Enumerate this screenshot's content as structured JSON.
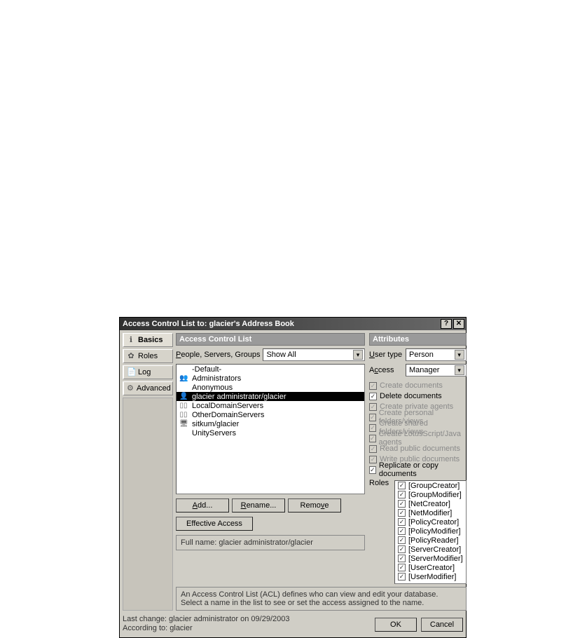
{
  "titlebar": {
    "title": "Access Control List to: glacier's Address Book",
    "help": "?",
    "close": "✕"
  },
  "sidebar": {
    "tabs": [
      {
        "icon": "ℹ",
        "label": "Basics"
      },
      {
        "icon": "✿",
        "label": "Roles"
      },
      {
        "icon": "📄",
        "label": "Log"
      },
      {
        "icon": "⚙",
        "label": "Advanced"
      }
    ]
  },
  "acl": {
    "header": "Access Control List",
    "filter_label": "People, Servers, Groups",
    "filter_value": "Show All",
    "items": [
      {
        "icon": "",
        "label": "-Default-"
      },
      {
        "icon": "👥",
        "label": "Administrators"
      },
      {
        "icon": "",
        "label": "Anonymous"
      },
      {
        "icon": "👤",
        "label": "glacier administrator/glacier",
        "selected": true
      },
      {
        "icon": "▯▯",
        "label": "LocalDomainServers"
      },
      {
        "icon": "▯▯",
        "label": "OtherDomainServers"
      },
      {
        "icon": "🖥",
        "label": "sitkum/glacier"
      },
      {
        "icon": "",
        "label": "UnityServers"
      }
    ],
    "buttons": {
      "add": "Add...",
      "rename": "Rename...",
      "remove": "Remove",
      "effective": "Effective Access"
    },
    "fullname_label": "Full name: glacier administrator/glacier",
    "hint": "An Access Control List (ACL) defines who can view and edit your database. Select a name in the list to see or set the access assigned to the name."
  },
  "attributes": {
    "header": "Attributes",
    "usertype_label": "User type",
    "usertype_value": "Person",
    "access_label": "Access",
    "access_value": "Manager",
    "perms": [
      {
        "label": "Create documents",
        "checked": true,
        "disabled": true,
        "u": "C"
      },
      {
        "label": "Delete documents",
        "checked": true,
        "disabled": false,
        "u": "D"
      },
      {
        "label": "Create private agents",
        "checked": true,
        "disabled": true,
        "u2": "p"
      },
      {
        "label": "Create personal folders/views",
        "checked": true,
        "disabled": true,
        "u2": "e"
      },
      {
        "label": "Create shared folders/views",
        "checked": true,
        "disabled": true,
        "u": "s"
      },
      {
        "label": "Create LotusScript/Java agents",
        "checked": true,
        "disabled": true,
        "u": "L"
      },
      {
        "label": "Read public documents",
        "checked": true,
        "disabled": true,
        "u": "R"
      },
      {
        "label": "Write public documents",
        "checked": true,
        "disabled": true,
        "u": "W"
      },
      {
        "label": "Replicate or copy documents",
        "checked": true,
        "disabled": false
      }
    ],
    "roles_label": "Roles",
    "roles": [
      "[GroupCreator]",
      "[GroupModifier]",
      "[NetCreator]",
      "[NetModifier]",
      "[PolicyCreator]",
      "[PolicyModifier]",
      "[PolicyReader]",
      "[ServerCreator]",
      "[ServerModifier]",
      "[UserCreator]",
      "[UserModifier]"
    ]
  },
  "footer": {
    "line1": "Last change: glacier administrator on 09/29/2003",
    "line2": "According to: glacier",
    "ok": "OK",
    "cancel": "Cancel"
  }
}
